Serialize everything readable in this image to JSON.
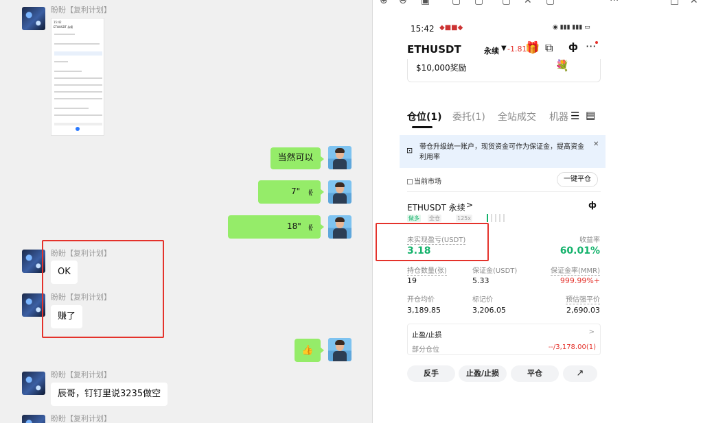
{
  "chat": {
    "sender_name": "盼盼【复利计划】",
    "thumbnail_screenshot": {
      "time": "15:42",
      "title": "ETHUSDT 永续"
    },
    "messages": [
      {
        "text": "当然可以"
      },
      {
        "text": "7\""
      },
      {
        "text": "18\""
      },
      {
        "text": "OK"
      },
      {
        "text": "赚了"
      },
      {
        "text": "👍"
      },
      {
        "text": "辰哥，钉钉里说3235做空"
      }
    ]
  },
  "phone": {
    "status": {
      "time": "15:42",
      "signal": "LTE"
    },
    "header": {
      "pair": "ETHUSDT",
      "type": "永续",
      "change": "-1.81%"
    },
    "banner": {
      "reward": "$10,000奖励"
    },
    "tabs": [
      "仓位(1)",
      "委托(1)",
      "全站成交",
      "机器"
    ],
    "notice": "带仓升级统一账户，现货资金可作为保证金，提高资金利用率",
    "filter": {
      "current_market": "当前市场",
      "close_all": "一键平仓"
    },
    "position": {
      "name": "ETHUSDT 永续",
      "tags": [
        "做多",
        "全仓",
        "125x"
      ],
      "unrealized_pnl_label": "未实现盈亏(USDT)",
      "unrealized_pnl_value": "3.18",
      "roe_label": "收益率",
      "roe_value": "60.01%",
      "qty_label": "持仓数量(张)",
      "qty_value": "19",
      "margin_label": "保证金(USDT)",
      "margin_value": "5.33",
      "mmr_label": "保证金率(MMR)",
      "mmr_value": "999.99%+",
      "entry_label": "开仓均价",
      "entry_value": "3,189.85",
      "mark_label": "标记价",
      "mark_value": "3,206.05",
      "liq_label": "预估强平价",
      "liq_value": "2,690.03",
      "tpsl_label": "止盈/止损",
      "partial_label": "部分仓位",
      "partial_value": "--/3,178.00(1)"
    },
    "actions": [
      "反手",
      "止盈/止损",
      "平仓"
    ]
  },
  "colors": {
    "green": "#13b26b",
    "red": "#e4322b",
    "bubble_green": "#95ec69"
  }
}
